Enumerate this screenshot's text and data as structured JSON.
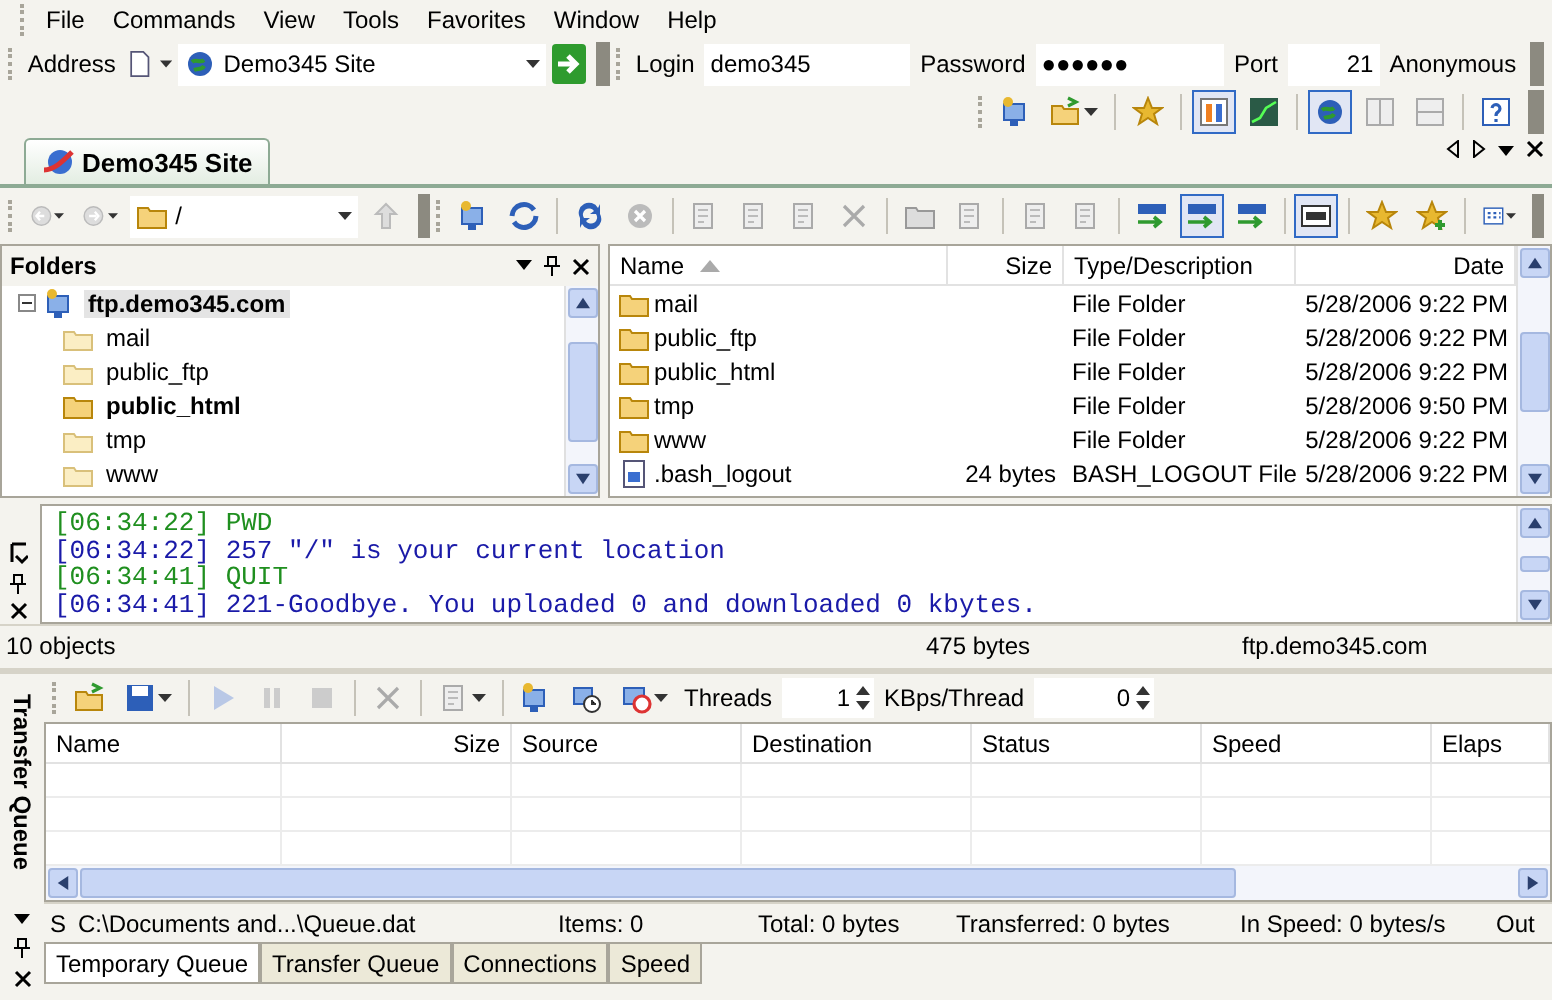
{
  "menu": [
    {
      "label": "File"
    },
    {
      "label": "Commands"
    },
    {
      "label": "View"
    },
    {
      "label": "Tools"
    },
    {
      "label": "Favorites"
    },
    {
      "label": "Window"
    },
    {
      "label": "Help"
    }
  ],
  "address_bar": {
    "address_label": "Address",
    "site": "Demo345 Site",
    "login_label": "Login",
    "login": "demo345",
    "password_label": "Password",
    "password": "●●●●●●",
    "port_label": "Port",
    "port": "21",
    "anonymous": "Anonymous"
  },
  "main_toolbar": {
    "buttons": [
      {
        "selected": false
      },
      {
        "selected": false
      },
      {
        "selected": false
      },
      {
        "selected": true
      },
      {
        "selected": false
      },
      {
        "selected": true
      },
      {
        "selected": false
      },
      {
        "selected": false
      },
      {
        "selected": false
      }
    ]
  },
  "tabs": [
    {
      "label": "Demo345 Site",
      "selected": true
    }
  ],
  "site_toolbar": {
    "path": "/",
    "buttons": [
      {
        "disabled": false,
        "selected": false
      },
      {
        "disabled": false,
        "selected": false
      },
      {
        "disabled": false,
        "selected": false
      },
      {
        "disabled": true,
        "selected": false
      },
      {
        "disabled": true,
        "selected": false
      },
      {
        "disabled": true,
        "selected": false
      },
      {
        "disabled": true,
        "selected": false
      },
      {
        "disabled": true,
        "selected": false
      },
      {
        "disabled": true,
        "selected": false
      },
      {
        "disabled": true,
        "selected": false
      },
      {
        "disabled": true,
        "selected": false
      },
      {
        "disabled": true,
        "selected": false
      },
      {
        "disabled": false,
        "selected": false
      },
      {
        "disabled": false,
        "selected": true
      },
      {
        "disabled": false,
        "selected": false
      },
      {
        "disabled": false,
        "selected": true
      },
      {
        "disabled": false,
        "selected": false
      },
      {
        "disabled": false,
        "selected": false
      },
      {
        "disabled": false,
        "selected": false
      }
    ]
  },
  "folders": {
    "title": "Folders",
    "tree": [
      {
        "label": "ftp.demo345.com",
        "expanded": true,
        "selected": true,
        "bold": true,
        "children": [
          {
            "label": "mail",
            "bold": false
          },
          {
            "label": "public_ftp",
            "bold": false
          },
          {
            "label": "public_html",
            "bold": true
          },
          {
            "label": "tmp",
            "bold": false
          },
          {
            "label": "www",
            "bold": false
          }
        ]
      }
    ]
  },
  "files": {
    "columns": [
      {
        "label": "Name",
        "sorted": true
      },
      {
        "label": "Size",
        "sorted": false
      },
      {
        "label": "Type/Description",
        "sorted": false
      },
      {
        "label": "Date",
        "sorted": false
      }
    ],
    "rows": [
      {
        "kind": "folder",
        "name": "mail",
        "type": "File Folder",
        "date": "5/28/2006 9:22 PM"
      },
      {
        "kind": "folder",
        "name": "public_ftp",
        "type": "File Folder",
        "date": "5/28/2006 9:22 PM"
      },
      {
        "kind": "folder",
        "name": "public_html",
        "type": "File Folder",
        "date": "5/28/2006 9:22 PM"
      },
      {
        "kind": "folder",
        "name": "tmp",
        "type": "File Folder",
        "date": "5/28/2006 9:50 PM"
      },
      {
        "kind": "folder",
        "name": "www",
        "type": "File Folder",
        "date": "5/28/2006 9:22 PM"
      },
      {
        "kind": "file",
        "name": ".bash_logout",
        "size": "24 bytes",
        "type": "BASH_LOGOUT File",
        "date": "5/28/2006 9:22 PM"
      }
    ]
  },
  "log": [
    {
      "kind": "command",
      "text": "[06:34:22] PWD"
    },
    {
      "kind": "reply",
      "text": "[06:34:22] 257 \"/\" is your current location"
    },
    {
      "kind": "command",
      "text": "[06:34:41] QUIT"
    },
    {
      "kind": "reply",
      "text": "[06:34:41] 221-Goodbye. You uploaded 0 and downloaded 0 kbytes."
    }
  ],
  "status_bar": [
    "10 objects",
    "475 bytes",
    "ftp.demo345.com"
  ],
  "queue": {
    "side_label": "Transfer Queue",
    "threads_label": "Threads",
    "threads": "1",
    "kbps_label": "KBps/Thread",
    "kbps": "0",
    "columns": [
      "Name",
      "Size",
      "Source",
      "Destination",
      "Status",
      "Speed",
      "Elaps"
    ],
    "status": [
      "S",
      "C:\\Documents and...\\Queue.dat",
      "Items: 0",
      "Total: 0 bytes",
      "Transferred: 0 bytes",
      "In Speed: 0 bytes/s",
      "Out"
    ],
    "tabs": [
      {
        "label": "Temporary Queue",
        "selected": true
      },
      {
        "label": "Transfer Queue",
        "selected": false
      },
      {
        "label": "Connections",
        "selected": false
      },
      {
        "label": "Speed",
        "selected": false
      }
    ]
  }
}
